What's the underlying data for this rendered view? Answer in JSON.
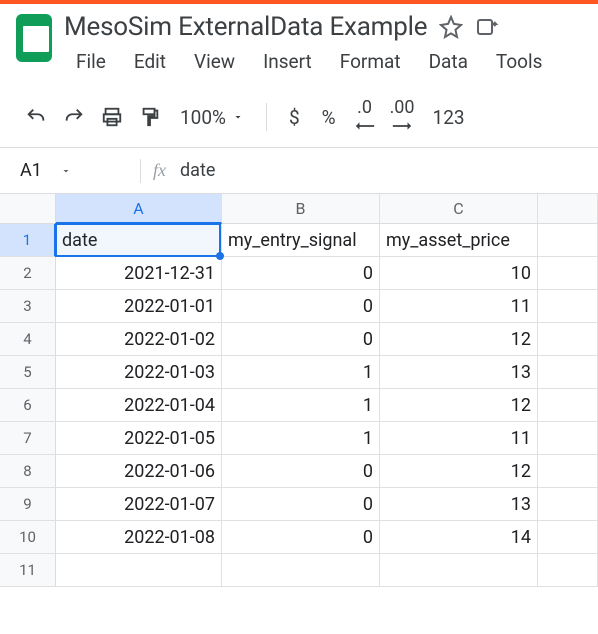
{
  "doc": {
    "title": "MesoSim ExternalData Example"
  },
  "menu": {
    "file": "File",
    "edit": "Edit",
    "view": "View",
    "insert": "Insert",
    "format": "Format",
    "data": "Data",
    "tools": "Tools"
  },
  "toolbar": {
    "zoom": "100%",
    "currency": "$",
    "percent": "%",
    "dec_dec": ".0",
    "inc_dec": ".00",
    "num123": "123"
  },
  "namebox": {
    "cell": "A1",
    "formula": "date"
  },
  "sheet": {
    "columns": [
      "A",
      "B",
      "C"
    ],
    "selected_col": 0,
    "selected_row": 0,
    "headers": [
      "date",
      "my_entry_signal",
      "my_asset_price"
    ],
    "rows": [
      {
        "a": "2021-12-31",
        "b": "0",
        "c": "10"
      },
      {
        "a": "2022-01-01",
        "b": "0",
        "c": "11"
      },
      {
        "a": "2022-01-02",
        "b": "0",
        "c": "12"
      },
      {
        "a": "2022-01-03",
        "b": "1",
        "c": "13"
      },
      {
        "a": "2022-01-04",
        "b": "1",
        "c": "12"
      },
      {
        "a": "2022-01-05",
        "b": "1",
        "c": "11"
      },
      {
        "a": "2022-01-06",
        "b": "0",
        "c": "12"
      },
      {
        "a": "2022-01-07",
        "b": "0",
        "c": "13"
      },
      {
        "a": "2022-01-08",
        "b": "0",
        "c": "14"
      }
    ],
    "empty_rows": 1
  }
}
